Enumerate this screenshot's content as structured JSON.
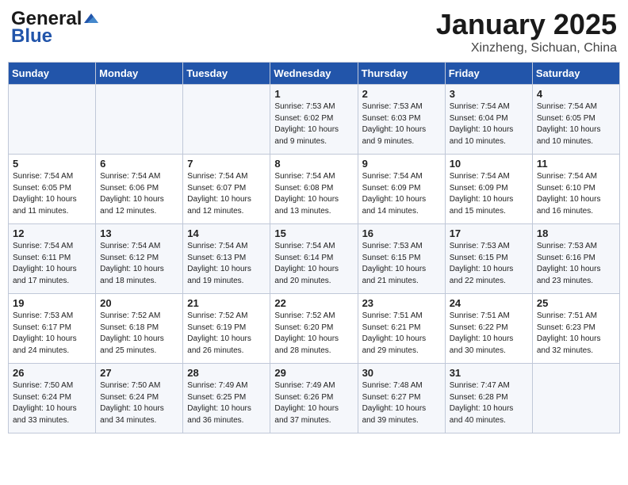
{
  "header": {
    "logo_general": "General",
    "logo_blue": "Blue",
    "month_title": "January 2025",
    "location": "Xinzheng, Sichuan, China"
  },
  "weekdays": [
    "Sunday",
    "Monday",
    "Tuesday",
    "Wednesday",
    "Thursday",
    "Friday",
    "Saturday"
  ],
  "weeks": [
    [
      {
        "day": "",
        "info": ""
      },
      {
        "day": "",
        "info": ""
      },
      {
        "day": "",
        "info": ""
      },
      {
        "day": "1",
        "info": "Sunrise: 7:53 AM\nSunset: 6:02 PM\nDaylight: 10 hours\nand 9 minutes."
      },
      {
        "day": "2",
        "info": "Sunrise: 7:53 AM\nSunset: 6:03 PM\nDaylight: 10 hours\nand 9 minutes."
      },
      {
        "day": "3",
        "info": "Sunrise: 7:54 AM\nSunset: 6:04 PM\nDaylight: 10 hours\nand 10 minutes."
      },
      {
        "day": "4",
        "info": "Sunrise: 7:54 AM\nSunset: 6:05 PM\nDaylight: 10 hours\nand 10 minutes."
      }
    ],
    [
      {
        "day": "5",
        "info": "Sunrise: 7:54 AM\nSunset: 6:05 PM\nDaylight: 10 hours\nand 11 minutes."
      },
      {
        "day": "6",
        "info": "Sunrise: 7:54 AM\nSunset: 6:06 PM\nDaylight: 10 hours\nand 12 minutes."
      },
      {
        "day": "7",
        "info": "Sunrise: 7:54 AM\nSunset: 6:07 PM\nDaylight: 10 hours\nand 12 minutes."
      },
      {
        "day": "8",
        "info": "Sunrise: 7:54 AM\nSunset: 6:08 PM\nDaylight: 10 hours\nand 13 minutes."
      },
      {
        "day": "9",
        "info": "Sunrise: 7:54 AM\nSunset: 6:09 PM\nDaylight: 10 hours\nand 14 minutes."
      },
      {
        "day": "10",
        "info": "Sunrise: 7:54 AM\nSunset: 6:09 PM\nDaylight: 10 hours\nand 15 minutes."
      },
      {
        "day": "11",
        "info": "Sunrise: 7:54 AM\nSunset: 6:10 PM\nDaylight: 10 hours\nand 16 minutes."
      }
    ],
    [
      {
        "day": "12",
        "info": "Sunrise: 7:54 AM\nSunset: 6:11 PM\nDaylight: 10 hours\nand 17 minutes."
      },
      {
        "day": "13",
        "info": "Sunrise: 7:54 AM\nSunset: 6:12 PM\nDaylight: 10 hours\nand 18 minutes."
      },
      {
        "day": "14",
        "info": "Sunrise: 7:54 AM\nSunset: 6:13 PM\nDaylight: 10 hours\nand 19 minutes."
      },
      {
        "day": "15",
        "info": "Sunrise: 7:54 AM\nSunset: 6:14 PM\nDaylight: 10 hours\nand 20 minutes."
      },
      {
        "day": "16",
        "info": "Sunrise: 7:53 AM\nSunset: 6:15 PM\nDaylight: 10 hours\nand 21 minutes."
      },
      {
        "day": "17",
        "info": "Sunrise: 7:53 AM\nSunset: 6:15 PM\nDaylight: 10 hours\nand 22 minutes."
      },
      {
        "day": "18",
        "info": "Sunrise: 7:53 AM\nSunset: 6:16 PM\nDaylight: 10 hours\nand 23 minutes."
      }
    ],
    [
      {
        "day": "19",
        "info": "Sunrise: 7:53 AM\nSunset: 6:17 PM\nDaylight: 10 hours\nand 24 minutes."
      },
      {
        "day": "20",
        "info": "Sunrise: 7:52 AM\nSunset: 6:18 PM\nDaylight: 10 hours\nand 25 minutes."
      },
      {
        "day": "21",
        "info": "Sunrise: 7:52 AM\nSunset: 6:19 PM\nDaylight: 10 hours\nand 26 minutes."
      },
      {
        "day": "22",
        "info": "Sunrise: 7:52 AM\nSunset: 6:20 PM\nDaylight: 10 hours\nand 28 minutes."
      },
      {
        "day": "23",
        "info": "Sunrise: 7:51 AM\nSunset: 6:21 PM\nDaylight: 10 hours\nand 29 minutes."
      },
      {
        "day": "24",
        "info": "Sunrise: 7:51 AM\nSunset: 6:22 PM\nDaylight: 10 hours\nand 30 minutes."
      },
      {
        "day": "25",
        "info": "Sunrise: 7:51 AM\nSunset: 6:23 PM\nDaylight: 10 hours\nand 32 minutes."
      }
    ],
    [
      {
        "day": "26",
        "info": "Sunrise: 7:50 AM\nSunset: 6:24 PM\nDaylight: 10 hours\nand 33 minutes."
      },
      {
        "day": "27",
        "info": "Sunrise: 7:50 AM\nSunset: 6:24 PM\nDaylight: 10 hours\nand 34 minutes."
      },
      {
        "day": "28",
        "info": "Sunrise: 7:49 AM\nSunset: 6:25 PM\nDaylight: 10 hours\nand 36 minutes."
      },
      {
        "day": "29",
        "info": "Sunrise: 7:49 AM\nSunset: 6:26 PM\nDaylight: 10 hours\nand 37 minutes."
      },
      {
        "day": "30",
        "info": "Sunrise: 7:48 AM\nSunset: 6:27 PM\nDaylight: 10 hours\nand 39 minutes."
      },
      {
        "day": "31",
        "info": "Sunrise: 7:47 AM\nSunset: 6:28 PM\nDaylight: 10 hours\nand 40 minutes."
      },
      {
        "day": "",
        "info": ""
      }
    ]
  ]
}
